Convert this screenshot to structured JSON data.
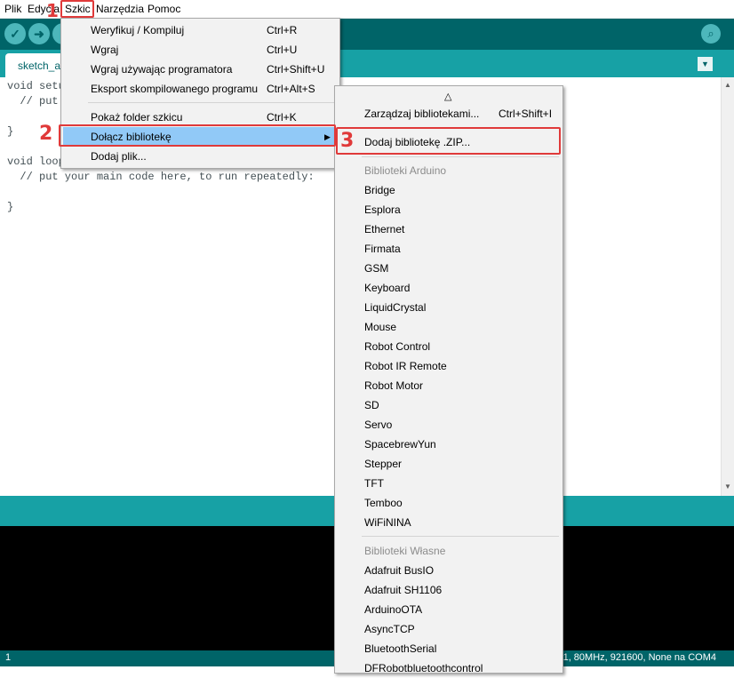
{
  "menubar": {
    "items": [
      "Plik",
      "Edycja",
      "Szkic",
      "Narzędzia",
      "Pomoc"
    ]
  },
  "toolbar": {
    "verify_icon": "check-icon",
    "upload_icon": "arrow-right-icon",
    "serial_icon": "magnifier-icon"
  },
  "tab": {
    "name": "sketch_a"
  },
  "editor": {
    "lines": [
      "void setu",
      "  // put",
      "",
      "}",
      "",
      "void loop",
      "  // put your main code here, to run repeatedly:",
      "",
      "}"
    ]
  },
  "sketch_menu": {
    "items": [
      {
        "label": "Weryfikuj / Kompiluj",
        "shortcut": "Ctrl+R"
      },
      {
        "label": "Wgraj",
        "shortcut": "Ctrl+U"
      },
      {
        "label": "Wgraj używając programatora",
        "shortcut": "Ctrl+Shift+U"
      },
      {
        "label": "Eksport skompilowanego programu",
        "shortcut": "Ctrl+Alt+S"
      },
      {
        "label": "Pokaż folder szkicu",
        "shortcut": "Ctrl+K"
      },
      {
        "label": "Dołącz bibliotekę",
        "shortcut": ""
      },
      {
        "label": "Dodaj plik...",
        "shortcut": ""
      }
    ]
  },
  "library_menu": {
    "scroll_up_glyph": "△",
    "manage": {
      "label": "Zarządzaj bibliotekami...",
      "shortcut": "Ctrl+Shift+I"
    },
    "add_zip": "Dodaj bibliotekę .ZIP...",
    "arduino_header": "Biblioteki Arduino",
    "arduino_libs": [
      "Bridge",
      "Esplora",
      "Ethernet",
      "Firmata",
      "GSM",
      "Keyboard",
      "LiquidCrystal",
      "Mouse",
      "Robot Control",
      "Robot IR Remote",
      "Robot Motor",
      "SD",
      "Servo",
      "SpacebrewYun",
      "Stepper",
      "TFT",
      "Temboo",
      "WiFiNINA"
    ],
    "own_header": "Biblioteki Własne",
    "own_libs": [
      "Adafruit BusIO",
      "Adafruit SH1106",
      "ArduinoOTA",
      "AsyncTCP",
      "BluetoothSerial",
      "DFRobotbluetoothcontrol"
    ]
  },
  "annotations": {
    "step1": "1",
    "step2": "2",
    "step3": "3"
  },
  "status": {
    "line": "1",
    "board": "V1, 80MHz, 921600, None na COM4"
  },
  "colors": {
    "teal_dark": "#006468",
    "teal": "#17a1a5",
    "highlight": "#91c9f7",
    "annotation_red": "#e03a3a"
  }
}
